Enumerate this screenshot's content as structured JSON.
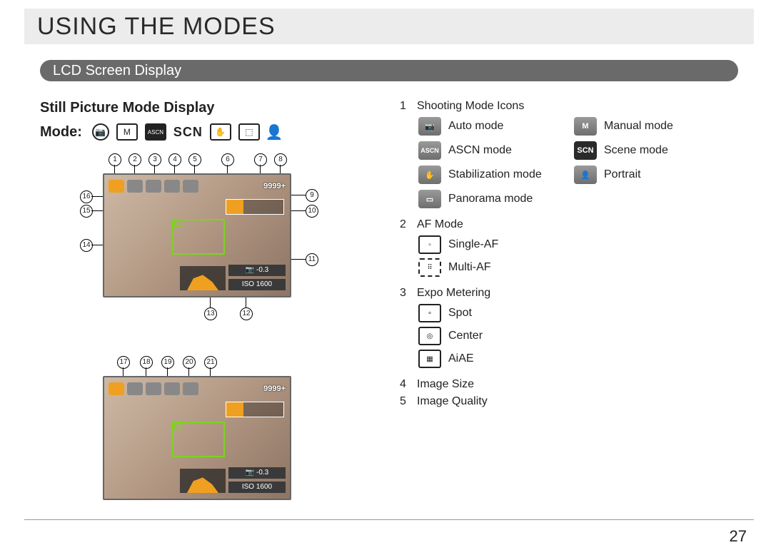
{
  "page": {
    "chapter_title": "USING THE MODES",
    "section_title": "LCD Screen Display",
    "page_number": "27"
  },
  "left": {
    "heading": "Still Picture Mode Display",
    "mode_label": "Mode:",
    "mode_icons": [
      "camera-icon",
      "manual-m-icon",
      "ascn-icon",
      "scn-text",
      "stabilization-icon",
      "panorama-icon",
      "portrait-icon"
    ],
    "scn_label": "SCN",
    "diagram1": {
      "callouts": [
        "1",
        "2",
        "3",
        "4",
        "5",
        "6",
        "7",
        "8",
        "9",
        "10",
        "11",
        "12",
        "13",
        "14",
        "15",
        "16"
      ],
      "counter": "9999+",
      "meter": "-0.3",
      "iso": "ISO 1600"
    },
    "diagram2": {
      "callouts": [
        "17",
        "18",
        "19",
        "20",
        "21"
      ],
      "counter": "9999+",
      "meter": "-0.3",
      "iso": "ISO 1600"
    }
  },
  "legend": {
    "items": [
      {
        "num": "1",
        "title": "Shooting Mode Icons",
        "icons": [
          {
            "name": "auto-mode-icon",
            "label": "Auto mode"
          },
          {
            "name": "manual-mode-icon",
            "label": "Manual mode"
          },
          {
            "name": "ascn-mode-icon",
            "label": "ASCN mode"
          },
          {
            "name": "scene-mode-icon",
            "label": "Scene mode"
          },
          {
            "name": "stabilization-mode-icon",
            "label": "Stabilization mode"
          },
          {
            "name": "portrait-mode-icon",
            "label": "Portrait"
          },
          {
            "name": "panorama-mode-icon",
            "label": "Panorama mode"
          }
        ]
      },
      {
        "num": "2",
        "title": "AF Mode",
        "subitems": [
          {
            "name": "single-af-icon",
            "label": "Single-AF"
          },
          {
            "name": "multi-af-icon",
            "label": "Multi-AF"
          }
        ]
      },
      {
        "num": "3",
        "title": "Expo Metering",
        "subitems": [
          {
            "name": "spot-metering-icon",
            "label": "Spot"
          },
          {
            "name": "center-metering-icon",
            "label": "Center"
          },
          {
            "name": "aiae-metering-icon",
            "label": "AiAE"
          }
        ]
      },
      {
        "num": "4",
        "title": "Image Size"
      },
      {
        "num": "5",
        "title": "Image Quality"
      }
    ],
    "icon_text": {
      "ascn": "ASCN",
      "scn": "SCN",
      "m": "M"
    }
  }
}
